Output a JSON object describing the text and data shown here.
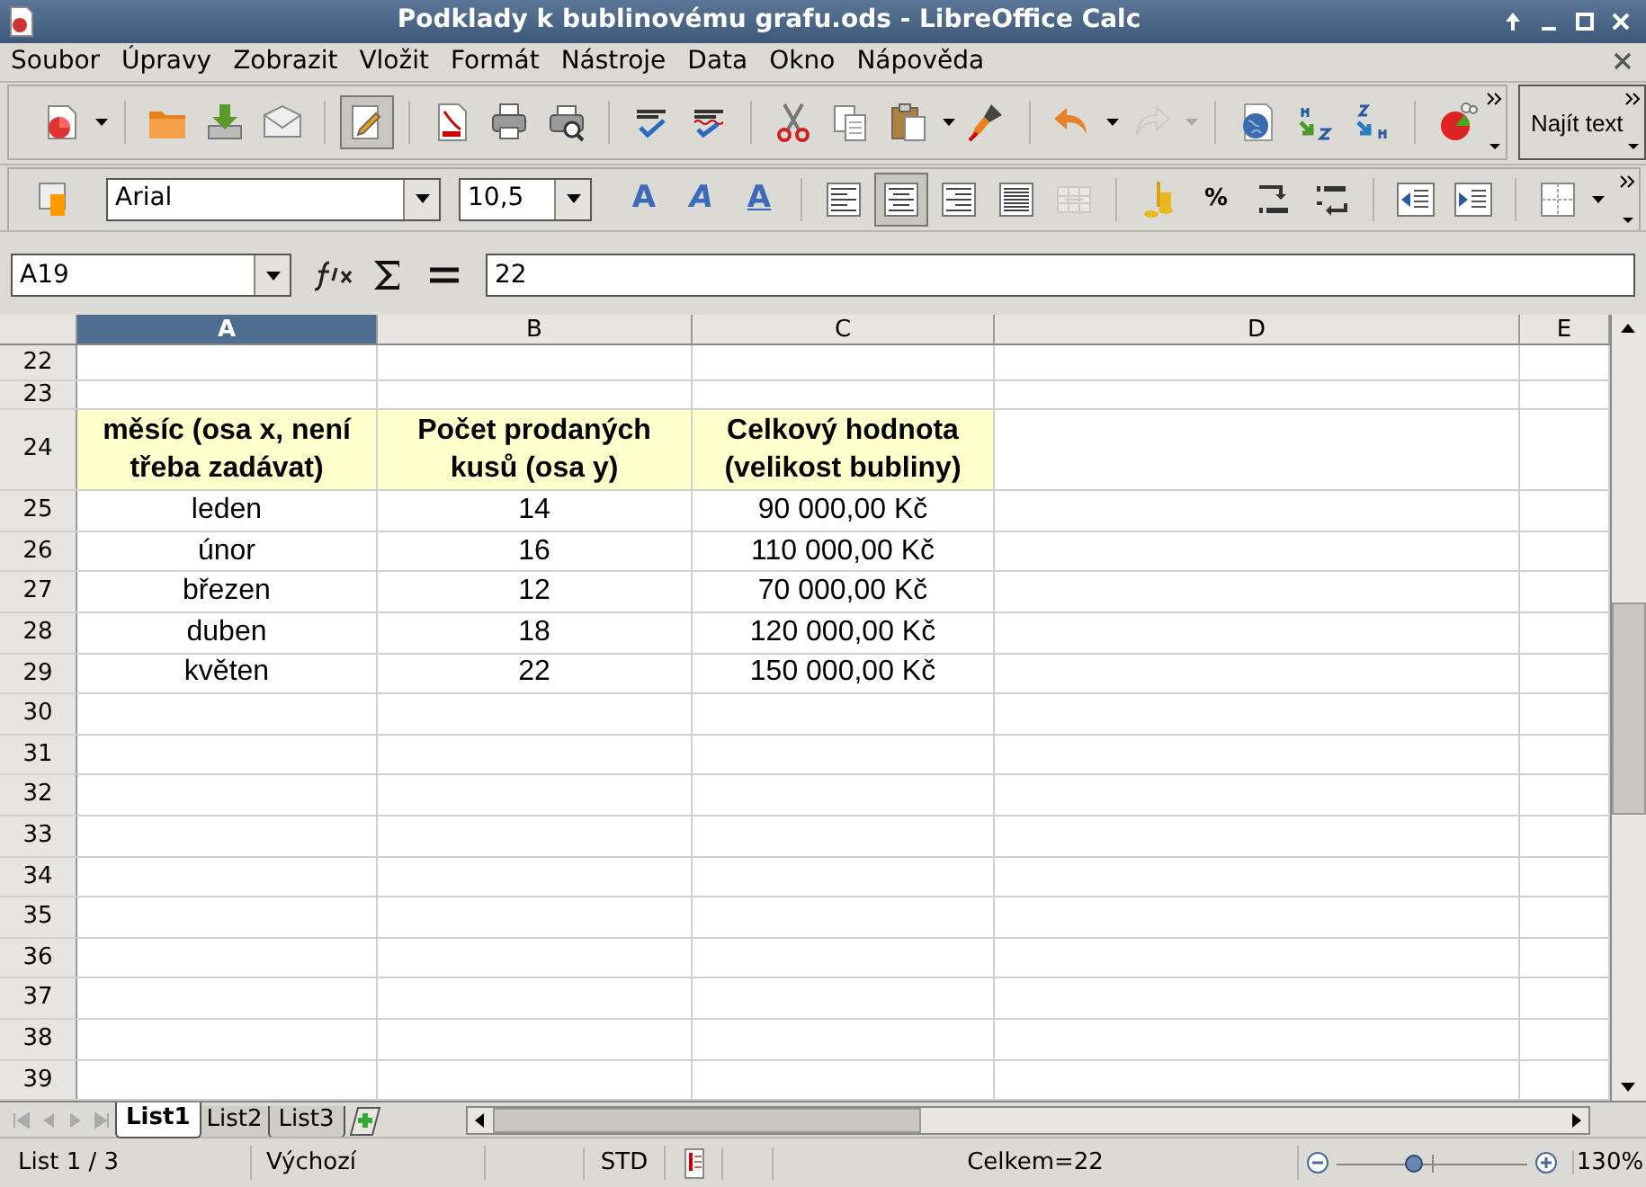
{
  "window": {
    "title": "Podklady k bublinovému grafu.ods - LibreOffice Calc"
  },
  "menu": [
    {
      "label": "Soubor"
    },
    {
      "label": "Úpravy"
    },
    {
      "label": "Zobrazit"
    },
    {
      "label": "Vložit"
    },
    {
      "label": "Formát"
    },
    {
      "label": "Nástroje"
    },
    {
      "label": "Data"
    },
    {
      "label": "Okno"
    },
    {
      "label": "Nápověda"
    }
  ],
  "standard_toolbar": [
    {
      "kind": "new"
    },
    {
      "kind": "caret"
    },
    {
      "kind": "sep"
    },
    {
      "kind": "open"
    },
    {
      "kind": "save"
    },
    {
      "kind": "email"
    },
    {
      "kind": "sep"
    },
    {
      "kind": "edit",
      "selected": true
    },
    {
      "kind": "sep"
    },
    {
      "kind": "pdf"
    },
    {
      "kind": "print"
    },
    {
      "kind": "preview"
    },
    {
      "kind": "sep"
    },
    {
      "kind": "spell"
    },
    {
      "kind": "autospell"
    },
    {
      "kind": "sep"
    },
    {
      "kind": "cut"
    },
    {
      "kind": "copy"
    },
    {
      "kind": "paste"
    },
    {
      "kind": "caret"
    },
    {
      "kind": "brush"
    },
    {
      "kind": "sep"
    },
    {
      "kind": "undo"
    },
    {
      "kind": "caret"
    },
    {
      "kind": "redo",
      "disabled": true
    },
    {
      "kind": "caret",
      "disabled": true
    },
    {
      "kind": "sep"
    },
    {
      "kind": "link"
    },
    {
      "kind": "sortasc"
    },
    {
      "kind": "sortdesc"
    },
    {
      "kind": "sep"
    },
    {
      "kind": "chart"
    }
  ],
  "find_toolbar": {
    "label": "Najít text"
  },
  "formatting_toolbar": {
    "font_name": "Arial",
    "font_size": "10,5",
    "buttons": [
      {
        "kind": "bold",
        "label": "A"
      },
      {
        "kind": "italic",
        "label": "A"
      },
      {
        "kind": "underline",
        "label": "A"
      },
      {
        "kind": "sep"
      },
      {
        "kind": "alignleft",
        "selected": false
      },
      {
        "kind": "aligncenter",
        "selected": true
      },
      {
        "kind": "alignright",
        "selected": false
      },
      {
        "kind": "justify",
        "selected": false
      },
      {
        "kind": "merge",
        "disabled": true
      },
      {
        "kind": "sep"
      },
      {
        "kind": "currency"
      },
      {
        "kind": "text",
        "label": "%"
      },
      {
        "kind": "adddec"
      },
      {
        "kind": "deldec"
      },
      {
        "kind": "sep"
      },
      {
        "kind": "outdent"
      },
      {
        "kind": "indent"
      },
      {
        "kind": "sep"
      },
      {
        "kind": "borders"
      },
      {
        "kind": "caret"
      }
    ]
  },
  "formula_bar": {
    "name_box": "A19",
    "content": "22"
  },
  "sheet": {
    "columns": [
      {
        "label": "A",
        "selected": true
      },
      {
        "label": "B",
        "selected": false
      },
      {
        "label": "C",
        "selected": false
      },
      {
        "label": "D",
        "selected": false
      },
      {
        "label": "E",
        "selected": false
      }
    ],
    "rows": [
      {
        "header": "22",
        "kind": "empty",
        "cells": []
      },
      {
        "header": "23",
        "kind": "narrow",
        "cells": []
      },
      {
        "header": "24",
        "kind": "heading",
        "cells": [
          "měsíc (osa x, není třeba zadávat)",
          "Počet prodaných kusů (osa y)",
          "Celkový hodnota (velikost bubliny)"
        ]
      },
      {
        "header": "25",
        "kind": "data",
        "cells": [
          "leden",
          "14",
          "90 000,00 Kč"
        ]
      },
      {
        "header": "26",
        "kind": "data",
        "cells": [
          "únor",
          "16",
          "110 000,00 Kč"
        ]
      },
      {
        "header": "27",
        "kind": "data",
        "cells": [
          "březen",
          "12",
          "70 000,00 Kč"
        ]
      },
      {
        "header": "28",
        "kind": "data",
        "cells": [
          "duben",
          "18",
          "120 000,00 Kč"
        ]
      },
      {
        "header": "29",
        "kind": "data",
        "cells": [
          "květen",
          "22",
          "150 000,00 Kč"
        ]
      },
      {
        "header": "30",
        "kind": "data",
        "cells": []
      },
      {
        "header": "31",
        "kind": "data",
        "cells": []
      },
      {
        "header": "32",
        "kind": "data",
        "cells": []
      },
      {
        "header": "33",
        "kind": "data",
        "cells": []
      },
      {
        "header": "34",
        "kind": "data",
        "cells": []
      },
      {
        "header": "35",
        "kind": "data",
        "cells": []
      },
      {
        "header": "36",
        "kind": "data",
        "cells": []
      },
      {
        "header": "37",
        "kind": "data",
        "cells": []
      },
      {
        "header": "38",
        "kind": "data",
        "cells": []
      },
      {
        "header": "39",
        "kind": "data",
        "cells": []
      }
    ]
  },
  "sheet_tabs": [
    {
      "label": "List1",
      "selected": true
    },
    {
      "label": "List2",
      "selected": false
    },
    {
      "label": "List3",
      "selected": false
    }
  ],
  "status_bar": {
    "sheet": "List 1 / 3",
    "page_style": "Výchozí",
    "selection_mode": "STD",
    "sum": "Celkem=22",
    "zoom": {
      "level": 0.4
    },
    "zoom_label": "130%"
  }
}
